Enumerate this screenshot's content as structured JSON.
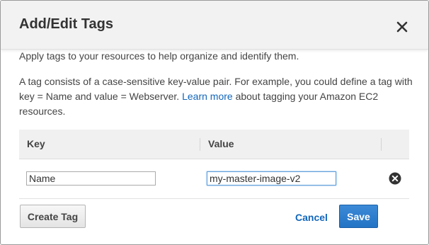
{
  "dialog": {
    "title": "Add/Edit Tags",
    "close_icon": "close-x-icon"
  },
  "body": {
    "intro": "Apply tags to your resources to help organize and identify them.",
    "desc_before": "A tag consists of a case-sensitive key-value pair. For example, you could define a tag with key = Name and value = Webserver.",
    "learn_more": "Learn more",
    "desc_after": "about tagging your Amazon EC2 resources."
  },
  "table": {
    "headers": {
      "key": "Key",
      "value": "Value"
    },
    "rows": [
      {
        "key": "Name",
        "value": "my-master-image-v2",
        "remove_icon": "remove-circle-x-icon"
      }
    ]
  },
  "footer": {
    "create_tag": "Create Tag",
    "cancel": "Cancel",
    "save": "Save"
  },
  "colors": {
    "link": "#1166bb",
    "primary_button": "#2a7bcb",
    "header_bg": "#f2f2f2"
  }
}
